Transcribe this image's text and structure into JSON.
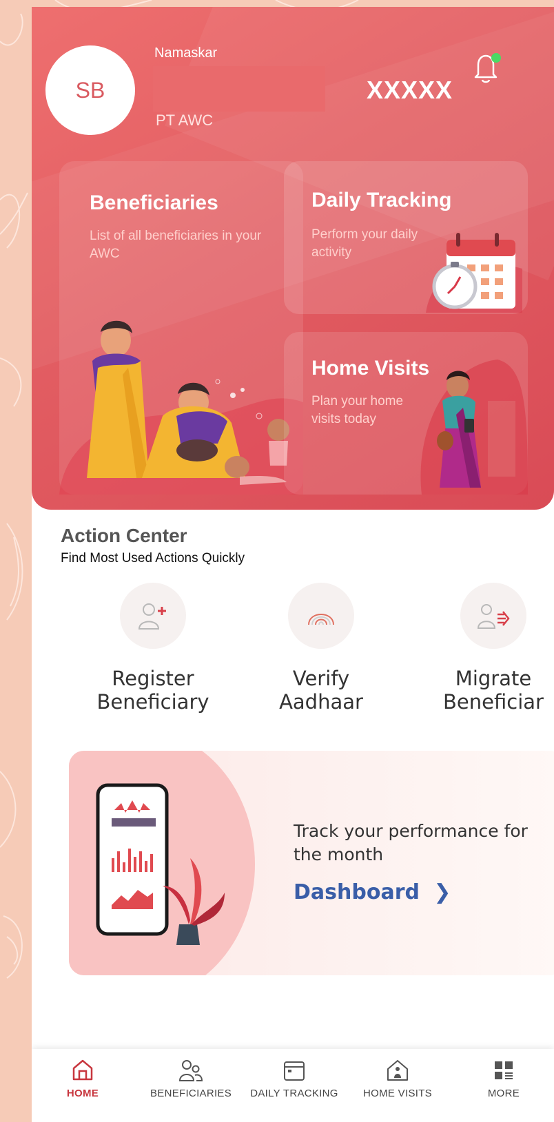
{
  "header": {
    "avatar_initials": "SB",
    "greeting": "Namaskar",
    "role": "PT AWC",
    "masked_id": "XXXXX"
  },
  "cards": {
    "beneficiaries": {
      "title": "Beneficiaries",
      "desc": "List of all beneficiaries in your AWC"
    },
    "daily_tracking": {
      "title": "Daily Tracking",
      "desc": "Perform your daily activity"
    },
    "home_visits": {
      "title": "Home Visits",
      "desc": "Plan your home visits today"
    }
  },
  "action_center": {
    "title": "Action Center",
    "subtitle": "Find Most Used Actions Quickly",
    "actions": [
      {
        "label": "Register\nBeneficiary",
        "icon": "add-user-icon"
      },
      {
        "label": "Verify\nAadhaar",
        "icon": "fingerprint-icon"
      },
      {
        "label": "Migrate\nBeneficiar",
        "icon": "migrate-user-icon"
      }
    ]
  },
  "dashboard": {
    "text": "Track your performance for the month",
    "link": "Dashboard",
    "link_icon": "chevron-right-icon"
  },
  "bottom_nav": [
    {
      "label": "HOME",
      "icon": "home-icon",
      "active": true
    },
    {
      "label": "BENEFICIARIES",
      "icon": "users-icon"
    },
    {
      "label": "DAILY TRACKING",
      "icon": "calendar-icon"
    },
    {
      "label": "HOME VISITS",
      "icon": "home-person-icon"
    },
    {
      "label": "MORE",
      "icon": "grid-menu-icon"
    }
  ],
  "colors": {
    "header": "#e25d62",
    "accent_red": "#c8373f",
    "link_blue": "#3a5ea8",
    "frame": "#f6cbb7"
  }
}
